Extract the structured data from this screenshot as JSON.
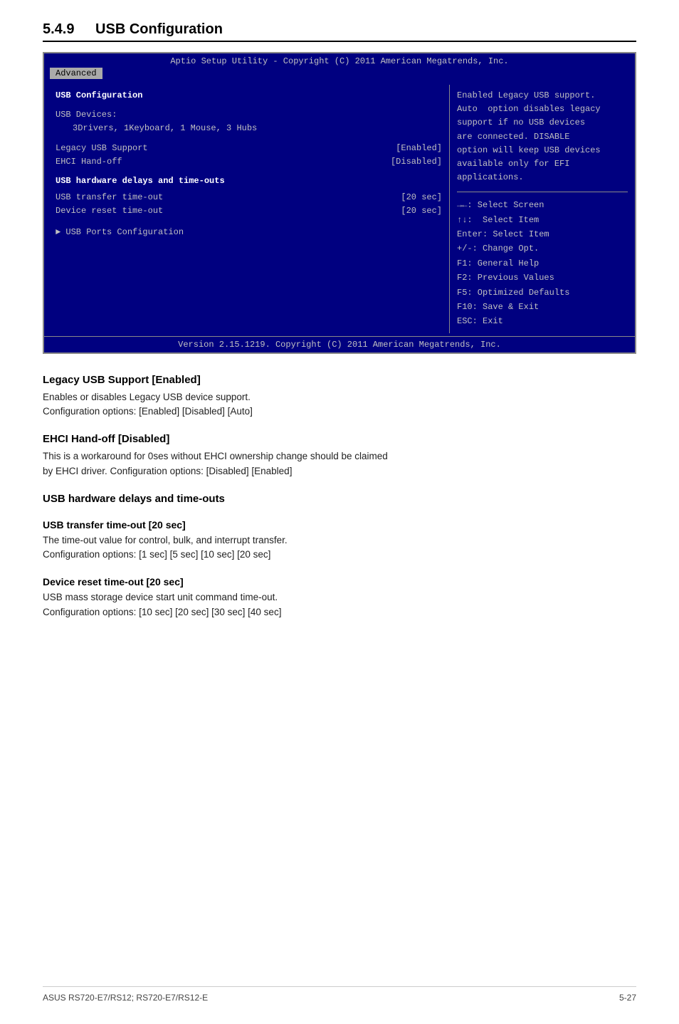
{
  "page": {
    "section_number": "5.4.9",
    "section_title": "USB Configuration"
  },
  "bios": {
    "header": "Aptio Setup Utility - Copyright (C) 2011 American Megatrends, Inc.",
    "active_tab": "Advanced",
    "footer": "Version 2.15.1219. Copyright (C) 2011 American Megatrends, Inc.",
    "left_panel": {
      "title": "USB Configuration",
      "devices_label": "USB Devices:",
      "devices_value": "3Drivers, 1Keyboard, 1 Mouse, 3 Hubs",
      "items": [
        {
          "name": "Legacy USB Support",
          "value": "[Enabled]"
        },
        {
          "name": "EHCI Hand-off",
          "value": "[Disabled]"
        }
      ],
      "hardware_section": "USB hardware delays and time-outs",
      "hardware_items": [
        {
          "name": "USB transfer time-out",
          "value": "[20 sec]"
        },
        {
          "name": "Device reset time-out",
          "value": "[20 sec]"
        }
      ],
      "submenu": "USB Ports Configuration"
    },
    "right_panel": {
      "help_text": "Enabled Legacy USB support.\nAuto  option disables legacy\nsupport if no USB devices\nare connected. DISABLE\noption will keep USB devices\navailable only for EFI\napplications.",
      "keys": [
        "→←: Select Screen",
        "↑↓:  Select Item",
        "Enter: Select Item",
        "+/-: Change Opt.",
        "F1: General Help",
        "F2: Previous Values",
        "F5: Optimized Defaults",
        "F10: Save & Exit",
        "ESC: Exit"
      ]
    }
  },
  "doc_sections": [
    {
      "id": "legacy-usb",
      "heading": "Legacy USB Support [Enabled]",
      "body": "Enables or disables Legacy USB device support.\nConfiguration options: [Enabled] [Disabled] [Auto]"
    },
    {
      "id": "ehci-handoff",
      "heading": "EHCI Hand-off [Disabled]",
      "body": "This is a workaround for 0ses without EHCI ownership change should be claimed\nby EHCI driver. Configuration options: [Disabled] [Enabled]"
    },
    {
      "id": "usb-hardware",
      "heading": "USB hardware delays and time-outs",
      "body": ""
    },
    {
      "id": "usb-transfer",
      "heading": "USB transfer time-out [20 sec]",
      "body": "The time-out value for control, bulk, and interrupt transfer.\nConfiguration options: [1 sec] [5 sec] [10 sec] [20 sec]"
    },
    {
      "id": "device-reset",
      "heading": "Device reset time-out [20 sec]",
      "body": "USB mass storage device start unit command time-out.\nConfiguration options: [10 sec] [20 sec] [30 sec] [40 sec]"
    }
  ],
  "footer": {
    "left": "ASUS RS720-E7/RS12; RS720-E7/RS12-E",
    "right": "5-27"
  }
}
